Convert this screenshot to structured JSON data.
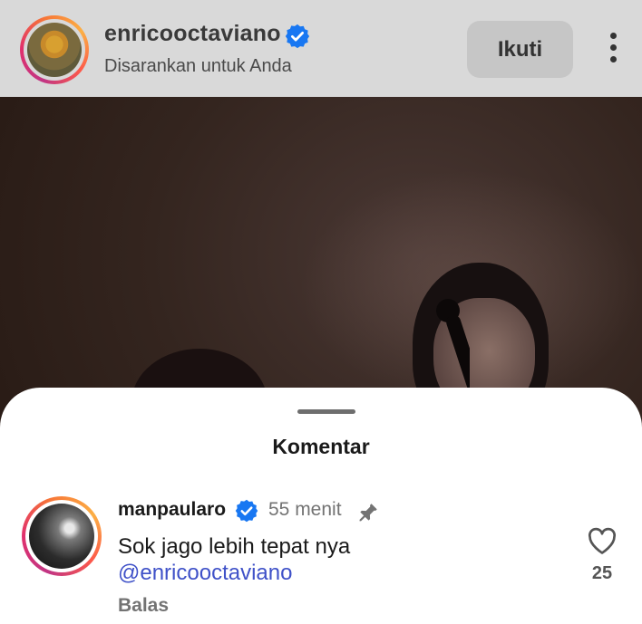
{
  "post": {
    "username": "enricooctaviano",
    "subtitle": "Disarankan untuk Anda",
    "follow_label": "Ikuti",
    "icons": [
      "verified-badge-icon",
      "more-options-icon"
    ]
  },
  "comments_sheet": {
    "title": "Komentar",
    "comment": {
      "username": "manpaularo",
      "time": "55 menit",
      "text": "Sok jago lebih tepat nya",
      "mention": "@enricooctaviano",
      "reply_label": "Balas",
      "like_count": "25",
      "icons": [
        "verified-badge-icon",
        "pin-icon",
        "heart-icon"
      ]
    }
  },
  "colors": {
    "verified_blue": "#1877f2",
    "mention_blue": "#3f51c8",
    "secondary_text": "#737373"
  }
}
